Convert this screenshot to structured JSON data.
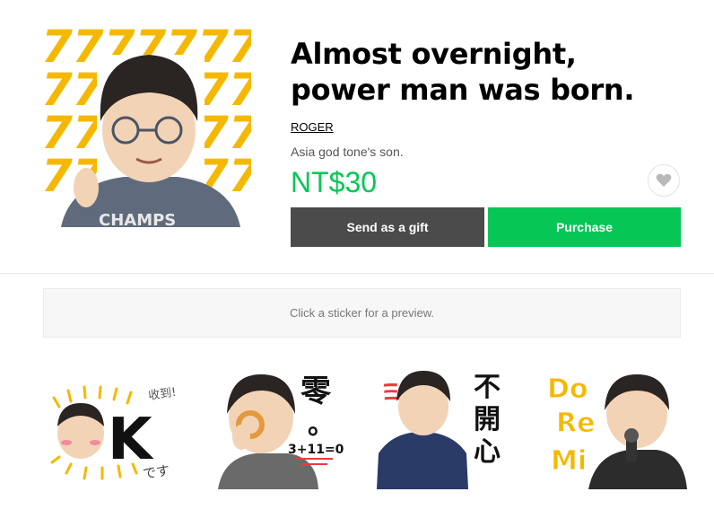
{
  "product": {
    "title": "Almost overnight, power man was born.",
    "author": "ROGER",
    "description": "Asia god tone's son.",
    "price": "NT$30",
    "main_image_text": "7777777"
  },
  "actions": {
    "gift_label": "Send as a gift",
    "purchase_label": "Purchase"
  },
  "preview": {
    "hint": "Click a sticker for a preview."
  },
  "stickers": [
    {
      "big": "K",
      "small_top": "收到!",
      "small_bottom": "です"
    },
    {
      "big": "零",
      "dot": "。",
      "equation": "3+11=0"
    },
    {
      "big": "不開心",
      "accent": "ミ"
    },
    {
      "lines": [
        "Do",
        "Re",
        "Mi"
      ]
    }
  ],
  "colors": {
    "brand_green": "#06c755",
    "gift_button": "#4b4b4b",
    "sticker_yellow": "#f5b800"
  }
}
